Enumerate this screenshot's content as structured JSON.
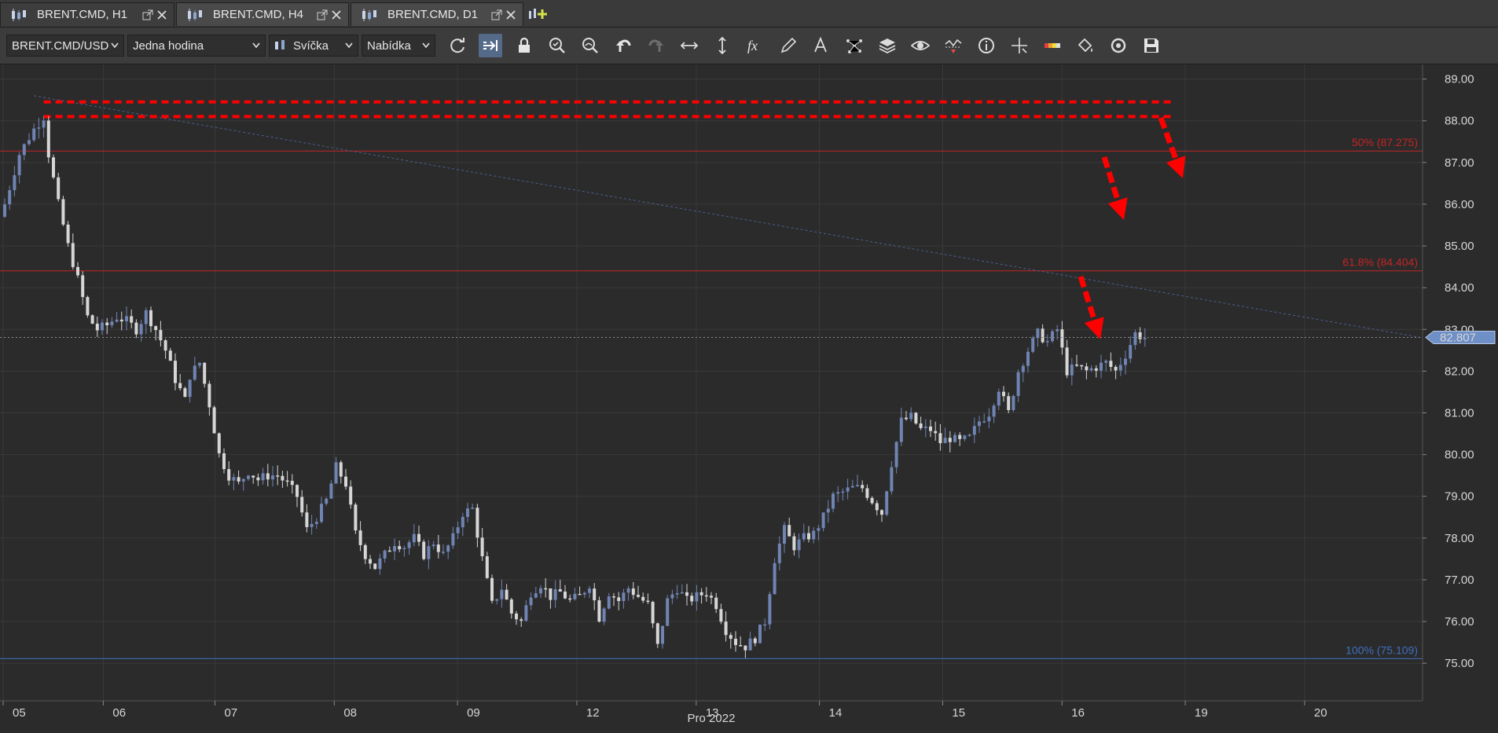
{
  "tabs": [
    {
      "label": "BRENT.CMD, H1",
      "active": true
    },
    {
      "label": "BRENT.CMD, H4",
      "active": false
    },
    {
      "label": "BRENT.CMD, D1",
      "active": false
    }
  ],
  "toolbar": {
    "instrument": "BRENT.CMD/USD",
    "period": "Jedna hodina",
    "chart_type": "Svíčka",
    "price_side": "Nabídka",
    "tools": [
      "refresh-icon",
      "autoshift-icon",
      "lock-icon",
      "zoom-in-icon",
      "zoom-out-icon",
      "undo-icon",
      "redo-icon",
      "horizontal-stretch-icon",
      "vertical-stretch-icon",
      "fx-icon",
      "pencil-icon",
      "text-icon",
      "pattern-icon",
      "layers-icon",
      "eye-icon",
      "alert-icon",
      "info-icon",
      "crosshair-icon",
      "color-scheme-icon",
      "paint-bucket-icon",
      "reset-icon",
      "save-icon"
    ]
  },
  "colors": {
    "background": "#2b2b2b",
    "grid": "#3a3a3a",
    "bull_candle": "#6f84b3",
    "bear_candle": "#d6d6d6",
    "fib_red": "#c42424",
    "fib_blue": "#3f6fc0",
    "annotation_red": "#ff0000",
    "price_marker": "#6f8fc7"
  },
  "chart_data": {
    "type": "candlestick",
    "symbol": "BRENT.CMD",
    "timeframe": "H1",
    "y_ticks": [
      "89.00",
      "88.00",
      "87.00",
      "86.00",
      "85.00",
      "84.00",
      "83.00",
      "82.00",
      "81.00",
      "80.00",
      "79.00",
      "78.00",
      "77.00",
      "76.00",
      "75.00"
    ],
    "ylim": [
      74.1,
      89.35
    ],
    "x_ticks": [
      "05",
      "06",
      "07",
      "08",
      "09",
      "12",
      "13",
      "14",
      "15",
      "16",
      "19",
      "20"
    ],
    "x_axis_caption": "Pro 2022",
    "current_price": "82.807",
    "fib_levels": [
      {
        "label": "50% (87.275)",
        "value": 87.275,
        "color": "#c42424"
      },
      {
        "label": "61.8% (84.404)",
        "value": 84.404,
        "color": "#c42424"
      },
      {
        "label": "100% (75.109)",
        "value": 75.109,
        "color": "#3f6fc0"
      }
    ],
    "resistance_band": [
      88.1,
      88.45
    ],
    "trendline": {
      "from": [
        0,
        88.6
      ],
      "to": [
        190,
        82.8
      ]
    },
    "close_path": [
      [
        0,
        86.0
      ],
      [
        3,
        87.2
      ],
      [
        6,
        87.8
      ],
      [
        8,
        88.1
      ],
      [
        9,
        87.2
      ],
      [
        11,
        86.0
      ],
      [
        13,
        85.0
      ],
      [
        15,
        84.2
      ],
      [
        17,
        83.3
      ],
      [
        19,
        83.0
      ],
      [
        21,
        83.1
      ],
      [
        23,
        83.3
      ],
      [
        25,
        83.2
      ],
      [
        27,
        83.0
      ],
      [
        29,
        83.4
      ],
      [
        31,
        83.0
      ],
      [
        33,
        82.5
      ],
      [
        35,
        81.8
      ],
      [
        37,
        81.3
      ],
      [
        38,
        81.9
      ],
      [
        40,
        82.2
      ],
      [
        42,
        81.2
      ],
      [
        44,
        80.0
      ],
      [
        46,
        79.5
      ],
      [
        48,
        79.3
      ],
      [
        50,
        79.6
      ],
      [
        52,
        79.4
      ],
      [
        54,
        79.5
      ],
      [
        56,
        79.5
      ],
      [
        58,
        79.3
      ],
      [
        60,
        79.0
      ],
      [
        62,
        78.2
      ],
      [
        64,
        78.5
      ],
      [
        66,
        78.9
      ],
      [
        68,
        79.7
      ],
      [
        70,
        79.3
      ],
      [
        72,
        78.1
      ],
      [
        74,
        77.6
      ],
      [
        76,
        77.3
      ],
      [
        78,
        77.6
      ],
      [
        80,
        77.9
      ],
      [
        82,
        77.8
      ],
      [
        84,
        78.0
      ],
      [
        86,
        77.6
      ],
      [
        88,
        77.9
      ],
      [
        90,
        77.6
      ],
      [
        92,
        78.0
      ],
      [
        94,
        78.6
      ],
      [
        96,
        78.7
      ],
      [
        98,
        77.5
      ],
      [
        100,
        76.4
      ],
      [
        102,
        76.8
      ],
      [
        104,
        76.2
      ],
      [
        106,
        76.0
      ],
      [
        108,
        76.7
      ],
      [
        110,
        76.9
      ],
      [
        112,
        76.6
      ],
      [
        114,
        76.7
      ],
      [
        116,
        76.5
      ],
      [
        118,
        76.6
      ],
      [
        120,
        76.9
      ],
      [
        122,
        76.1
      ],
      [
        124,
        76.7
      ],
      [
        126,
        76.5
      ],
      [
        128,
        76.8
      ],
      [
        130,
        76.6
      ],
      [
        132,
        76.4
      ],
      [
        134,
        75.4
      ],
      [
        136,
        76.5
      ],
      [
        138,
        76.8
      ],
      [
        140,
        76.5
      ],
      [
        142,
        76.6
      ],
      [
        144,
        76.7
      ],
      [
        146,
        76.4
      ],
      [
        148,
        75.8
      ],
      [
        150,
        75.5
      ],
      [
        152,
        75.4
      ],
      [
        154,
        75.6
      ],
      [
        156,
        76.0
      ],
      [
        158,
        77.5
      ],
      [
        160,
        78.2
      ],
      [
        162,
        77.8
      ],
      [
        164,
        78.0
      ],
      [
        166,
        78.1
      ],
      [
        168,
        78.5
      ],
      [
        170,
        79.0
      ],
      [
        172,
        79.1
      ],
      [
        174,
        79.2
      ],
      [
        176,
        79.2
      ],
      [
        178,
        78.9
      ],
      [
        180,
        78.6
      ],
      [
        182,
        79.8
      ],
      [
        184,
        80.8
      ],
      [
        186,
        80.9
      ],
      [
        188,
        80.6
      ],
      [
        190,
        80.6
      ],
      [
        192,
        80.3
      ],
      [
        194,
        80.4
      ],
      [
        196,
        80.3
      ],
      [
        198,
        80.4
      ],
      [
        200,
        80.8
      ],
      [
        202,
        81.0
      ],
      [
        204,
        81.6
      ],
      [
        206,
        81.0
      ],
      [
        208,
        82.0
      ],
      [
        210,
        82.5
      ],
      [
        212,
        82.9
      ],
      [
        214,
        82.7
      ],
      [
        216,
        83.0
      ],
      [
        218,
        82.0
      ],
      [
        220,
        82.1
      ],
      [
        222,
        82.0
      ],
      [
        224,
        82.1
      ],
      [
        226,
        82.2
      ],
      [
        228,
        82.0
      ],
      [
        230,
        82.4
      ],
      [
        232,
        82.9
      ],
      [
        234,
        82.8
      ]
    ],
    "annotations": [
      {
        "type": "arrow",
        "label": "down-arrow-1"
      },
      {
        "type": "arrow",
        "label": "down-arrow-2"
      },
      {
        "type": "arrow",
        "label": "down-arrow-3"
      }
    ]
  }
}
